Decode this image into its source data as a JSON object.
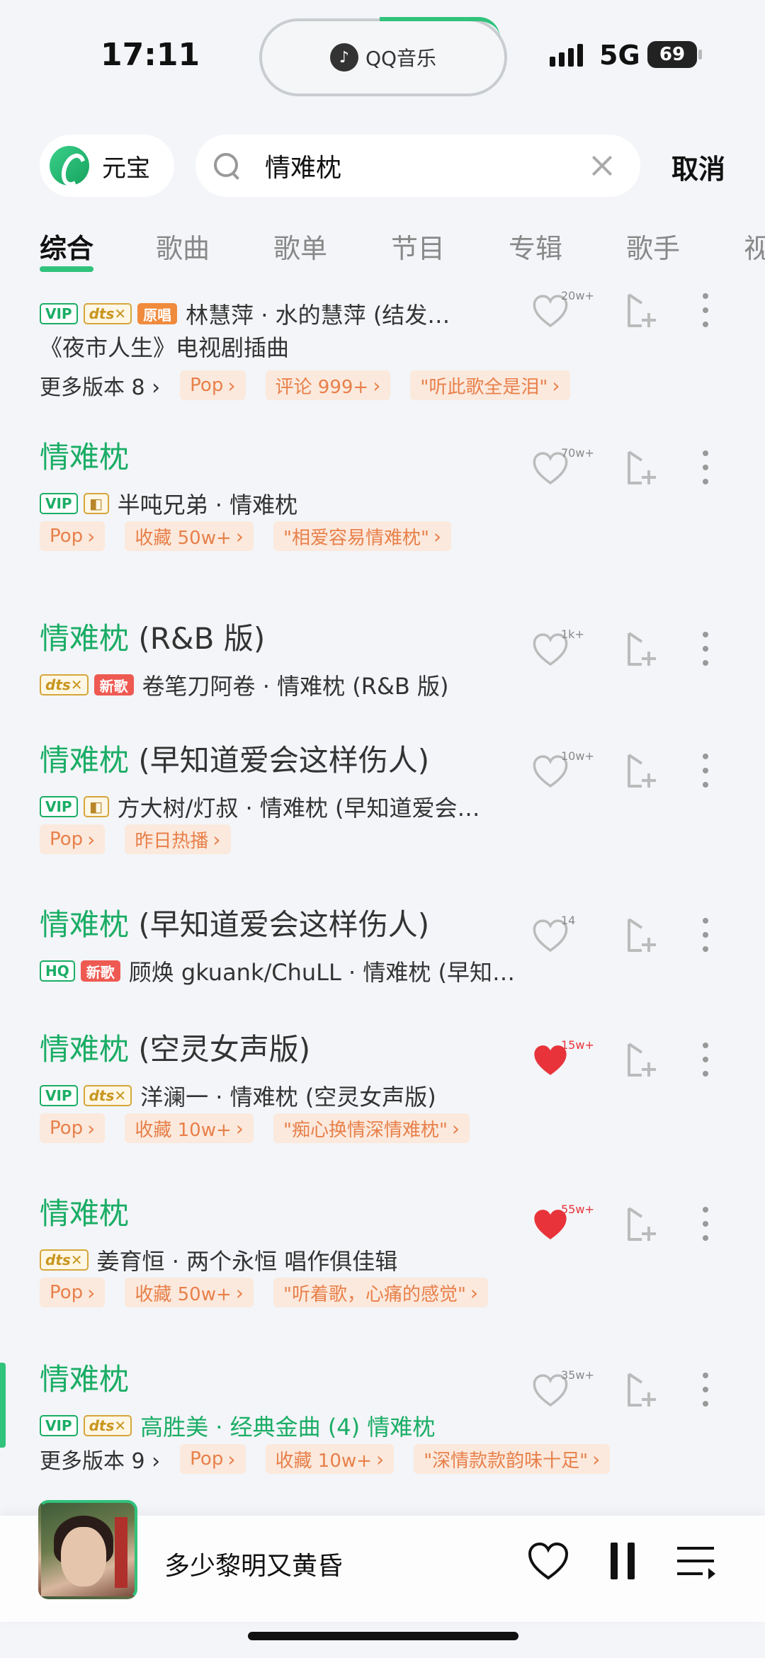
{
  "status": {
    "time": "17:11",
    "network": "5G",
    "battery": "69",
    "island_brand": "QQ音乐"
  },
  "search": {
    "yuanbao_label": "元宝",
    "query": "情难枕",
    "cancel_label": "取消"
  },
  "tabs": [
    "综合",
    "歌曲",
    "歌单",
    "节目",
    "专辑",
    "歌手",
    "视"
  ],
  "results": [
    {
      "badges": [
        "VIP",
        "dts",
        "原唱"
      ],
      "meta": "林慧萍 · 水的慧萍 (结发…",
      "subtitle": "《夜市人生》电视剧插曲",
      "more_versions": "更多版本 8 ›",
      "chips": [
        "Pop",
        "评论 999+",
        "\"听此歌全是泪\""
      ],
      "like_count": "20w+",
      "liked": false
    },
    {
      "title_green": "情难枕",
      "title_rest": "",
      "badges": [
        "VIP",
        "dolby"
      ],
      "meta": "半吨兄弟 · 情难枕",
      "chips": [
        "Pop",
        "收藏 50w+",
        "\"相爱容易情难枕\""
      ],
      "like_count": "70w+",
      "liked": false
    },
    {
      "title_green": "情难枕",
      "title_rest": " (R&B 版)",
      "badges": [
        "dts",
        "新歌"
      ],
      "meta": "卷笔刀阿卷 · 情难枕 (R&B 版)",
      "like_count": "1k+",
      "liked": false
    },
    {
      "title_green": "情难枕",
      "title_rest": " (早知道爱会这样伤人)",
      "badges": [
        "VIP",
        "dolby"
      ],
      "meta": "方大树/灯叔 · 情难枕 (早知道爱会…",
      "chips": [
        "Pop",
        "昨日热播"
      ],
      "like_count": "10w+",
      "liked": false
    },
    {
      "title_green": "情难枕",
      "title_rest": " (早知道爱会这样伤人)",
      "badges": [
        "HQ",
        "新歌"
      ],
      "meta": "顾焕 gkuank/ChuLL · 情难枕 (早知…",
      "like_count": "14",
      "liked": false
    },
    {
      "title_green": "情难枕",
      "title_rest": " (空灵女声版)",
      "badges": [
        "VIP",
        "dts"
      ],
      "meta": "洋澜一 · 情难枕 (空灵女声版)",
      "chips": [
        "Pop",
        "收藏 10w+",
        "\"痴心换情深情难枕\""
      ],
      "like_count": "15w+",
      "liked": true
    },
    {
      "title_green": "情难枕",
      "title_rest": "",
      "badges": [
        "dts"
      ],
      "meta": "姜育恒 · 两个永恒 唱作俱佳辑",
      "chips": [
        "Pop",
        "收藏 50w+",
        "\"听着歌，心痛的感觉\""
      ],
      "like_count": "55w+",
      "liked": true
    },
    {
      "title_green": "情难枕",
      "title_rest": "",
      "badges": [
        "VIP",
        "dts"
      ],
      "meta": "高胜美 · 经典金曲 (4) 情难枕",
      "more_versions": "更多版本 9 ›",
      "chips": [
        "Pop",
        "收藏 10w+",
        "\"深情款款韵味十足\""
      ],
      "like_count": "35w+",
      "liked": false
    }
  ],
  "player": {
    "title": "多少黎明又黄昏"
  },
  "colors": {
    "accent": "#31c27c",
    "chip_bg": "#fbe9dd",
    "chip_text": "#e8804a",
    "liked": "#e8333a"
  }
}
